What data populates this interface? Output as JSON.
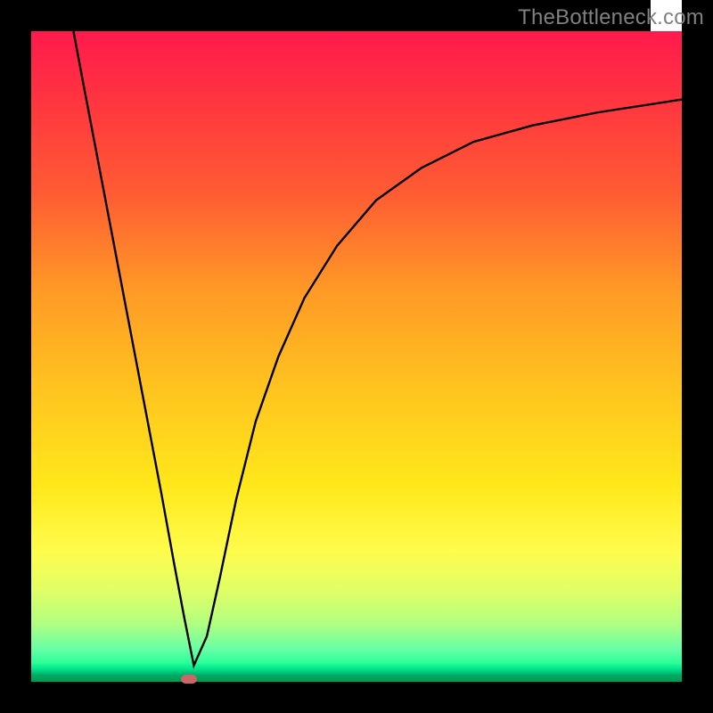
{
  "watermark": "TheBottleneck.com",
  "marker": {
    "x_frac": 0.242,
    "y_frac": 0.0
  },
  "chart_data": {
    "type": "line",
    "title": "",
    "xlabel": "",
    "ylabel": "",
    "xlim": [
      0,
      1
    ],
    "ylim": [
      0,
      1
    ],
    "series": [
      {
        "name": "curve",
        "x": [
          0.065,
          0.08,
          0.1,
          0.12,
          0.14,
          0.16,
          0.18,
          0.2,
          0.22,
          0.235,
          0.25,
          0.27,
          0.29,
          0.315,
          0.345,
          0.38,
          0.42,
          0.47,
          0.53,
          0.6,
          0.68,
          0.77,
          0.87,
          1.0
        ],
        "y": [
          1.0,
          0.92,
          0.815,
          0.71,
          0.605,
          0.5,
          0.395,
          0.29,
          0.18,
          0.1,
          0.025,
          0.07,
          0.16,
          0.28,
          0.4,
          0.5,
          0.59,
          0.67,
          0.74,
          0.79,
          0.83,
          0.855,
          0.875,
          0.895
        ]
      }
    ],
    "marker_point": {
      "x": 0.242,
      "y": 0.0,
      "color": "#cc6666"
    },
    "background_direction": "top_to_bottom",
    "background_stops": [
      {
        "pos": 0.0,
        "color": "#ff1a4d"
      },
      {
        "pos": 0.1,
        "color": "#ff3340"
      },
      {
        "pos": 0.25,
        "color": "#ff5c33"
      },
      {
        "pos": 0.4,
        "color": "#ff9a26"
      },
      {
        "pos": 0.55,
        "color": "#ffc41f"
      },
      {
        "pos": 0.7,
        "color": "#ffe81a"
      },
      {
        "pos": 0.8,
        "color": "#fffc4d"
      },
      {
        "pos": 0.86,
        "color": "#e0ff66"
      },
      {
        "pos": 0.91,
        "color": "#b3ff80"
      },
      {
        "pos": 0.95,
        "color": "#66ffa6"
      },
      {
        "pos": 0.97,
        "color": "#2eff99"
      },
      {
        "pos": 0.98,
        "color": "#00e88c"
      },
      {
        "pos": 0.99,
        "color": "#00aa66"
      },
      {
        "pos": 1.0,
        "color": "#00994d"
      }
    ]
  }
}
